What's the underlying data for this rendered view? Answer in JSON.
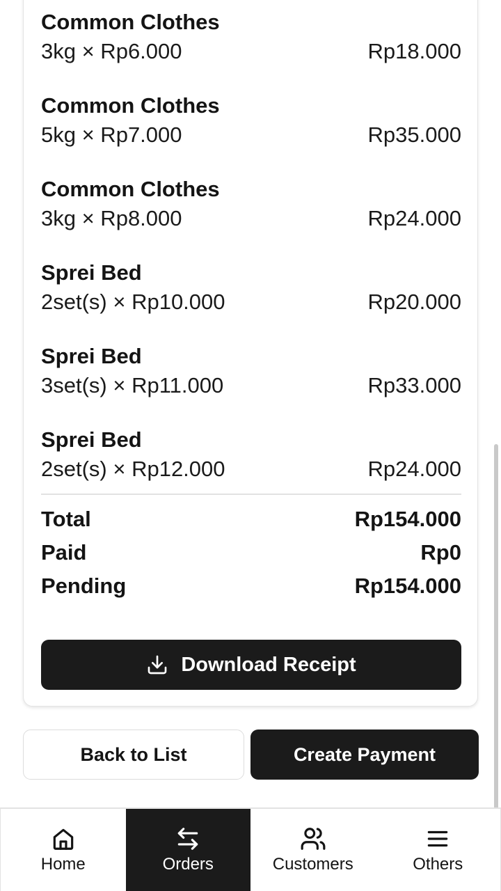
{
  "items": [
    {
      "name": "Common Clothes",
      "qty_price": "3kg × Rp6.000",
      "subtotal": "Rp18.000"
    },
    {
      "name": "Common Clothes",
      "qty_price": "5kg × Rp7.000",
      "subtotal": "Rp35.000"
    },
    {
      "name": "Common Clothes",
      "qty_price": "3kg × Rp8.000",
      "subtotal": "Rp24.000"
    },
    {
      "name": "Sprei Bed",
      "qty_price": "2set(s) × Rp10.000",
      "subtotal": "Rp20.000"
    },
    {
      "name": "Sprei Bed",
      "qty_price": "3set(s) × Rp11.000",
      "subtotal": "Rp33.000"
    },
    {
      "name": "Sprei Bed",
      "qty_price": "2set(s) × Rp12.000",
      "subtotal": "Rp24.000"
    }
  ],
  "summary": {
    "total_label": "Total",
    "total_value": "Rp154.000",
    "paid_label": "Paid",
    "paid_value": "Rp0",
    "pending_label": "Pending",
    "pending_value": "Rp154.000"
  },
  "actions": {
    "download_label": "Download Receipt",
    "download_icon": "download-icon",
    "back_label": "Back to List",
    "pay_label": "Create Payment"
  },
  "nav": {
    "items": [
      {
        "label": "Home",
        "icon": "home-icon"
      },
      {
        "label": "Orders",
        "icon": "arrows-left-right-icon"
      },
      {
        "label": "Customers",
        "icon": "users-icon"
      },
      {
        "label": "Others",
        "icon": "menu-icon"
      }
    ],
    "active": "Orders",
    "active_color": "#1b1b1b"
  }
}
